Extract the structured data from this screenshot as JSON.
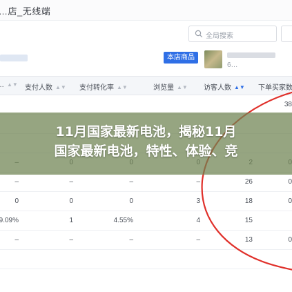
{
  "app": {
    "title": "…店_无线端"
  },
  "search": {
    "placeholder": "全局搜索"
  },
  "store_badge": "本店商品",
  "product": {
    "id": "6…"
  },
  "table": {
    "headers": [
      "…",
      "支付人数",
      "支付转化率",
      "浏览量",
      "访客人数",
      "下单买家数"
    ],
    "rows": [
      [
        "",
        "",
        "",
        "",
        "",
        "38"
      ],
      [
        "",
        "",
        "",
        "",
        "",
        ""
      ],
      [
        "",
        "",
        "",
        "",
        "",
        ""
      ],
      [
        "–",
        "0",
        "0",
        "0",
        "2",
        "0"
      ],
      [
        "–",
        "–",
        "–",
        "–",
        "26",
        "0"
      ],
      [
        "0",
        "0",
        "0",
        "3",
        "18",
        "0"
      ],
      [
        "9.09%",
        "1",
        "4.55%",
        "4",
        "15",
        ""
      ],
      [
        "–",
        "–",
        "–",
        "–",
        "13",
        "0"
      ],
      [
        "",
        "",
        "",
        "",
        "",
        ""
      ]
    ]
  },
  "headline": {
    "line1": "11月国家最新电池，揭秘11月",
    "line2": "国家最新电池，特性、体验、竞"
  },
  "colors": {
    "accent": "#2f6fe6",
    "annotation": "#e0302a"
  }
}
